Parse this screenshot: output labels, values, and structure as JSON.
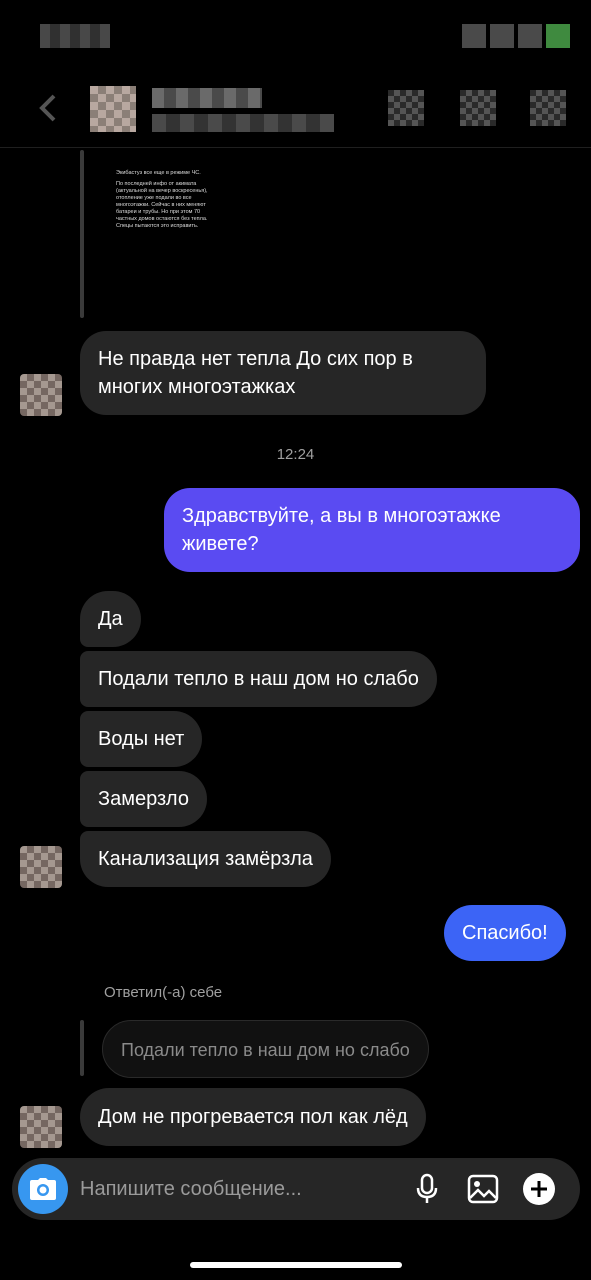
{
  "conversation": {
    "shared_post": {
      "lines": [
        "Экибастуз все еще в режиме ЧС.",
        "По последней инфо от акимата (актуальной на вечер воскресенья), отопление уже подали во все многоэтажки. Сейчас в них меняют батареи и трубы. Но при этом 70 частных домов остаются без тепла. Спецы пытаются это исправить."
      ]
    },
    "messages": [
      {
        "id": "m1",
        "text": "Не правда нет тепла До сих пор в многих многоэтажках"
      },
      {
        "id": "m2",
        "text": "Здравствуйте, а вы в многоэтажке живете?"
      },
      {
        "id": "m3",
        "text": "Да"
      },
      {
        "id": "m4",
        "text": "Подали тепло в наш дом но слабо"
      },
      {
        "id": "m5",
        "text": "Воды нет"
      },
      {
        "id": "m6",
        "text": "Замерзло"
      },
      {
        "id": "m7",
        "text": "Канализация замёрзла"
      },
      {
        "id": "m8",
        "text": "Спасибо!"
      },
      {
        "id": "m9",
        "text": "Дом не прогревается пол как лёд"
      }
    ],
    "time_separator": "12:24",
    "reply": {
      "label": "Ответил(-а) себе",
      "quote": "Подали тепло в наш дом но слабо"
    }
  },
  "composer": {
    "placeholder": "Напишите сообщение...",
    "icons": [
      "camera-icon",
      "microphone-icon",
      "gallery-icon",
      "add-icon"
    ]
  },
  "colors": {
    "background": "#000000",
    "incoming_bubble": "#262626",
    "outgoing_bubble_purple": "#5a4bf2",
    "outgoing_bubble_blue": "#3c64f6",
    "camera_button": "#3797f0"
  }
}
